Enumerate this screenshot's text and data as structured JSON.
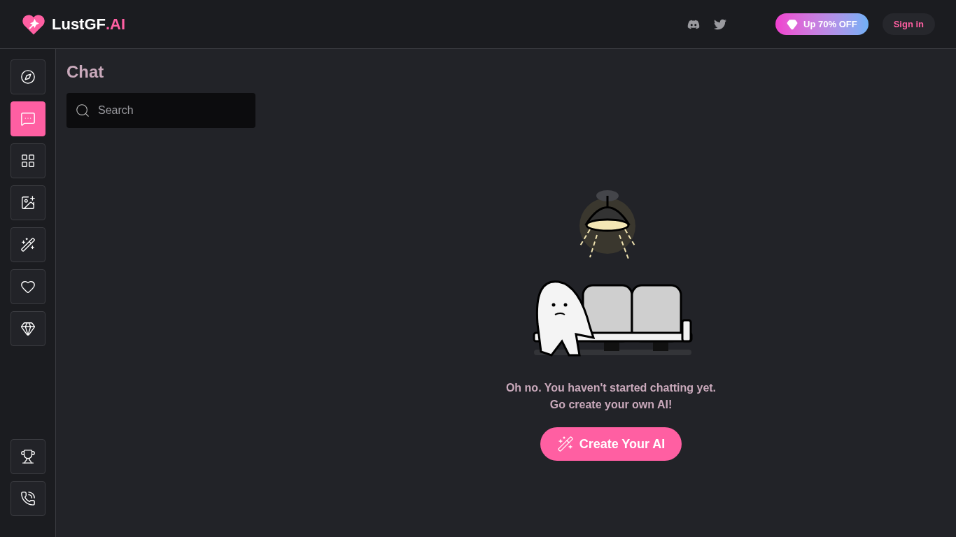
{
  "header": {
    "logo": {
      "name": "LustGF",
      "suffix": ".AI"
    },
    "social": [
      {
        "kind": "discord"
      },
      {
        "kind": "twitter"
      }
    ],
    "promo": "Up 70% OFF",
    "sign_in": "Sign in"
  },
  "nav": {
    "top": [
      {
        "kind": "explore",
        "selected": false
      },
      {
        "kind": "chat",
        "selected": true
      },
      {
        "kind": "gallery",
        "selected": false
      },
      {
        "kind": "generate",
        "selected": false
      },
      {
        "kind": "create",
        "selected": false
      },
      {
        "kind": "favorites",
        "selected": false
      },
      {
        "kind": "premium",
        "selected": false
      }
    ],
    "bottom": [
      {
        "kind": "rewards",
        "selected": false
      },
      {
        "kind": "contact",
        "selected": false
      }
    ]
  },
  "chat_panel": {
    "title": "Chat",
    "search": {
      "placeholder": "Search"
    }
  },
  "empty_state": {
    "lines": [
      "Oh no. You haven't started chatting yet.",
      "Go create your own AI!"
    ],
    "button": "Create Your AI"
  }
}
